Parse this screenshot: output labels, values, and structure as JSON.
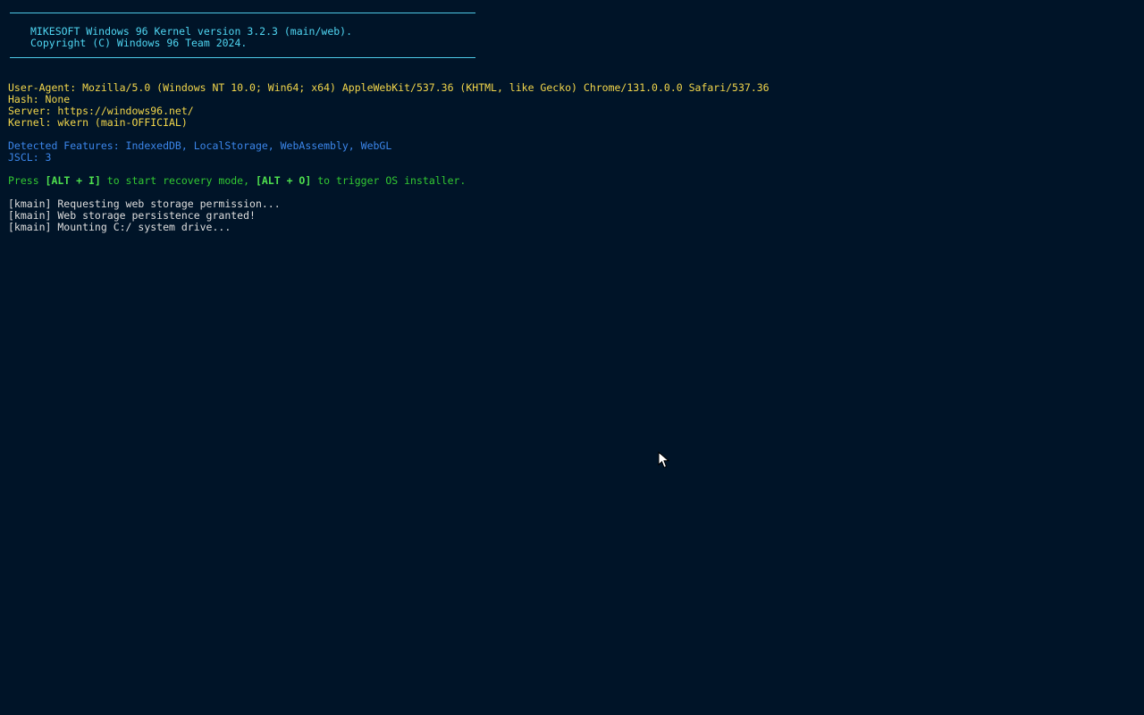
{
  "banner": {
    "line1": "MIKESOFT Windows 96 Kernel version 3.2.3 (main/web).",
    "line2": "Copyright (C) Windows 96 Team 2024."
  },
  "info": {
    "user_agent": "User-Agent: Mozilla/5.0 (Windows NT 10.0; Win64; x64) AppleWebKit/537.36 (KHTML, like Gecko) Chrome/131.0.0.0 Safari/537.36",
    "hash": "Hash: None",
    "server": "Server: https://windows96.net/",
    "kernel": "Kernel: wkern (main-OFFICIAL)"
  },
  "features": {
    "detected": "Detected Features: IndexedDB, LocalStorage, WebAssembly, WebGL",
    "jscl": "JSCL: 3"
  },
  "hint": {
    "prefix": "Press ",
    "key1": "[ALT + I]",
    "mid": " to start recovery mode, ",
    "key2": "[ALT + O]",
    "suffix": " to trigger OS installer."
  },
  "log": [
    "[kmain] Requesting web storage permission...",
    "[kmain] Web storage persistence granted!",
    "[kmain] Mounting C:/ system drive..."
  ],
  "colors": {
    "background": "#001428",
    "banner": "#4fd6f2",
    "info": "#f2d64b",
    "features": "#3b86ea",
    "hint": "#32c832",
    "log": "#dedede"
  },
  "icons": {
    "cursor": "mouse-pointer-icon"
  }
}
